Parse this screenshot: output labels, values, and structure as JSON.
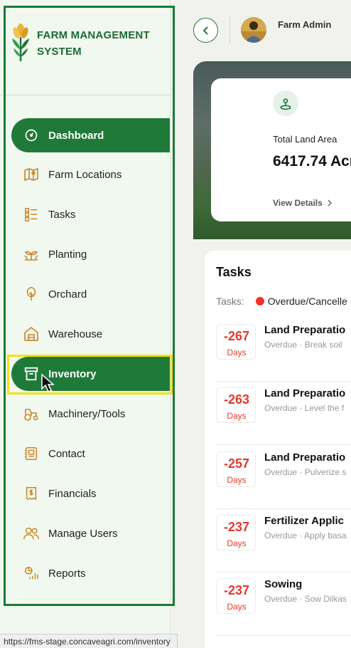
{
  "brand": {
    "title_line1": "FARM MANAGEMENT",
    "title_line2": "SYSTEM"
  },
  "nav": [
    {
      "label": "Dashboard",
      "icon": "dashboard-gauge-icon",
      "active": true
    },
    {
      "label": "Farm Locations",
      "icon": "map-location-icon"
    },
    {
      "label": "Tasks",
      "icon": "task-list-icon"
    },
    {
      "label": "Planting",
      "icon": "sprout-icon"
    },
    {
      "label": "Orchard",
      "icon": "tree-icon"
    },
    {
      "label": "Warehouse",
      "icon": "warehouse-icon"
    },
    {
      "label": "Inventory",
      "icon": "archive-box-icon",
      "active": true,
      "hovered": true
    },
    {
      "label": "Machinery/Tools",
      "icon": "tractor-icon"
    },
    {
      "label": "Contact",
      "icon": "contact-card-icon"
    },
    {
      "label": "Financials",
      "icon": "dollar-document-icon"
    },
    {
      "label": "Manage Users",
      "icon": "users-icon"
    },
    {
      "label": "Reports",
      "icon": "reports-chart-icon"
    }
  ],
  "header": {
    "user_name": "Farm Admin",
    "back_icon": "chevron-left-icon"
  },
  "land_card": {
    "label": "Total Land Area",
    "value": "6417.74 Acr",
    "link": "View Details"
  },
  "tasks": {
    "title": "Tasks",
    "legend_prefix": "Tasks:",
    "legend_label": "Overdue/Cancelle",
    "items": [
      {
        "days": "-267",
        "days_label": "Days",
        "name": "Land Preparatio",
        "sub": "Overdue · Break soil"
      },
      {
        "days": "-263",
        "days_label": "Days",
        "name": "Land Preparatio",
        "sub": "Overdue · Level the f"
      },
      {
        "days": "-257",
        "days_label": "Days",
        "name": "Land Preparatio",
        "sub": "Overdue · Pulverize s"
      },
      {
        "days": "-237",
        "days_label": "Days",
        "name": "Fertilizer Applic",
        "sub": "Overdue · Apply basa"
      },
      {
        "days": "-237",
        "days_label": "Days",
        "name": "Sowing",
        "sub": "Overdue · Sow Dilkas"
      }
    ]
  },
  "status_url": "https://fms-stage.concaveagri.com/inventory",
  "colors": {
    "brand_green": "#1f7a3a",
    "overdue_red": "#e33a2c",
    "highlight_yellow": "#f3e20f"
  }
}
